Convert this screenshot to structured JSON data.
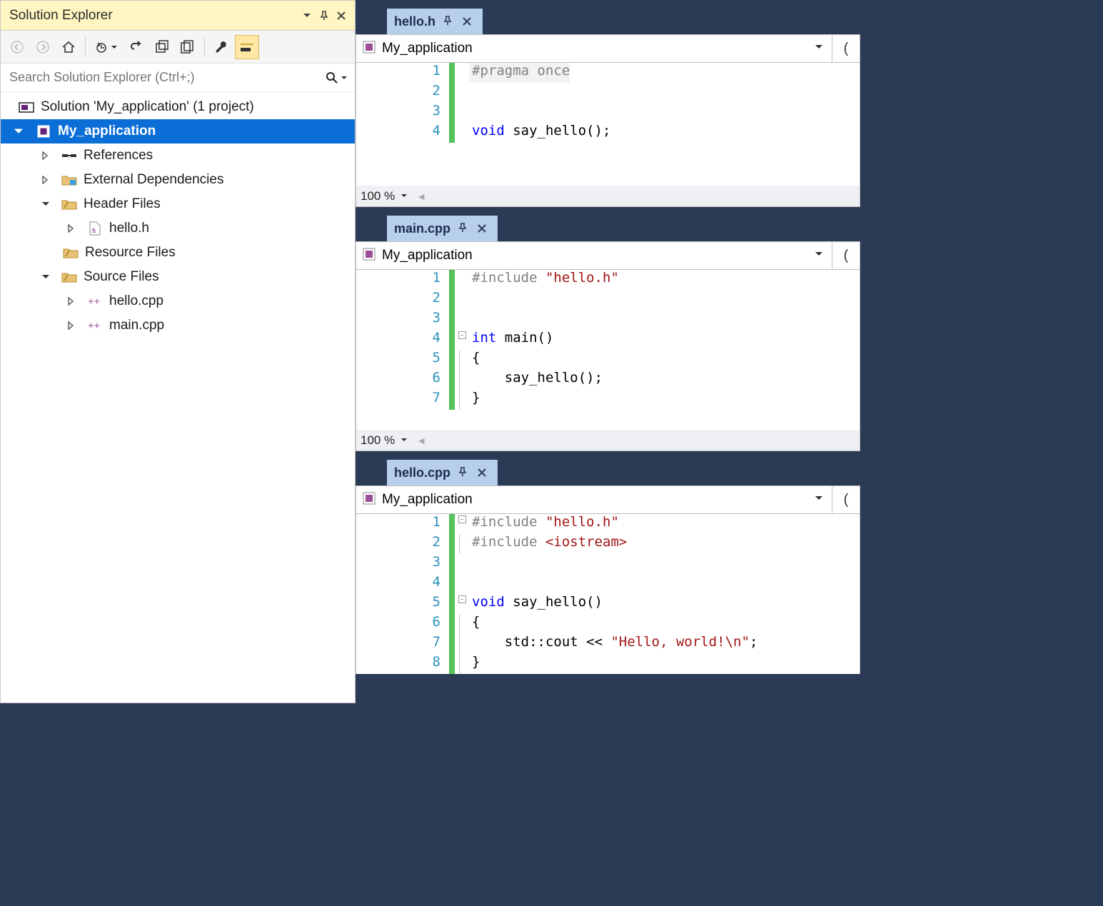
{
  "solution_explorer": {
    "title": "Solution Explorer",
    "search_placeholder": "Search Solution Explorer (Ctrl+;)",
    "tree": {
      "solution": "Solution 'My_application' (1 project)",
      "project": "My_application",
      "references": "References",
      "external_deps": "External Dependencies",
      "header_files": "Header Files",
      "hello_h": "hello.h",
      "resource_files": "Resource Files",
      "source_files": "Source Files",
      "hello_cpp": "hello.cpp",
      "main_cpp": "main.cpp"
    }
  },
  "editors": {
    "hello_h": {
      "tab": "hello.h",
      "scope": "My_application",
      "zoom": "100 %",
      "lines": {
        "l1": "#pragma once",
        "l4a": "void",
        "l4b": " say_hello();"
      }
    },
    "main_cpp": {
      "tab": "main.cpp",
      "scope": "My_application",
      "zoom": "100 %",
      "lines": {
        "l1a": "#include ",
        "l1b": "\"hello.h\"",
        "l4a": "int",
        "l4b": " main()",
        "l5": "{",
        "l6": "    say_hello();",
        "l7": "}"
      }
    },
    "hello_cpp": {
      "tab": "hello.cpp",
      "scope": "My_application",
      "lines": {
        "l1a": "#include ",
        "l1b": "\"hello.h\"",
        "l2a": "#include ",
        "l2b": "<iostream>",
        "l5a": "void",
        "l5b": " say_hello()",
        "l6": "{",
        "l7a": "    std::cout << ",
        "l7b": "\"Hello, world!\\n\"",
        "l7c": ";",
        "l8": "}"
      }
    }
  }
}
